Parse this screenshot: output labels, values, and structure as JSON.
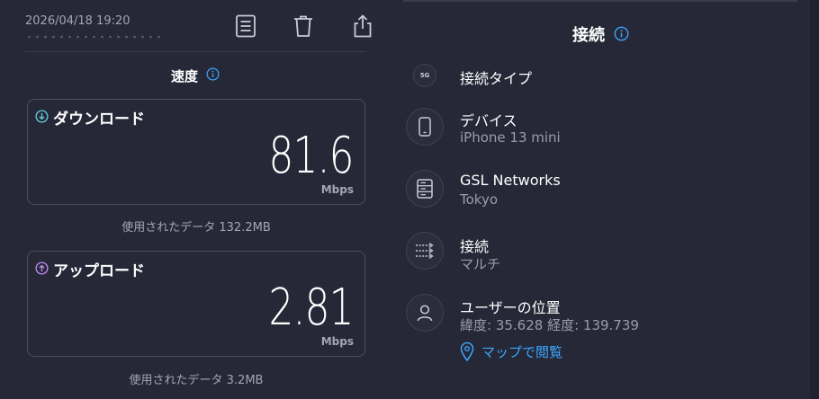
{
  "header": {
    "timestamp": "2026/04/18 19:20"
  },
  "toolbar": {
    "icons": [
      "results-list-icon",
      "trash-icon",
      "share-icon"
    ]
  },
  "speed": {
    "title": "速度",
    "download": {
      "label": "ダウンロード",
      "value": "81.6",
      "unit": "Mbps",
      "data_used": "使用されたデータ 132.2MB"
    },
    "upload": {
      "label": "アップロード",
      "value": "2.81",
      "unit": "Mbps",
      "data_used": "使用されたデータ 3.2MB"
    }
  },
  "connection": {
    "title": "接続",
    "type": {
      "badge": "5G",
      "label": "接続タイプ"
    },
    "device": {
      "label": "デバイス",
      "value": "iPhone 13 mini"
    },
    "server": {
      "label": "GSL Networks",
      "value": "Tokyo"
    },
    "mode": {
      "label": "接続",
      "value": "マルチ"
    },
    "location": {
      "label": "ユーザーの位置",
      "value": "緯度: 35.628  経度: 139.739",
      "map_link": "マップで閲覧"
    }
  },
  "colors": {
    "background": "#262837",
    "download_accent": "#5fd0e0",
    "upload_accent": "#c48cf0",
    "link": "#3aa6ff",
    "info": "#3aa6ff"
  }
}
